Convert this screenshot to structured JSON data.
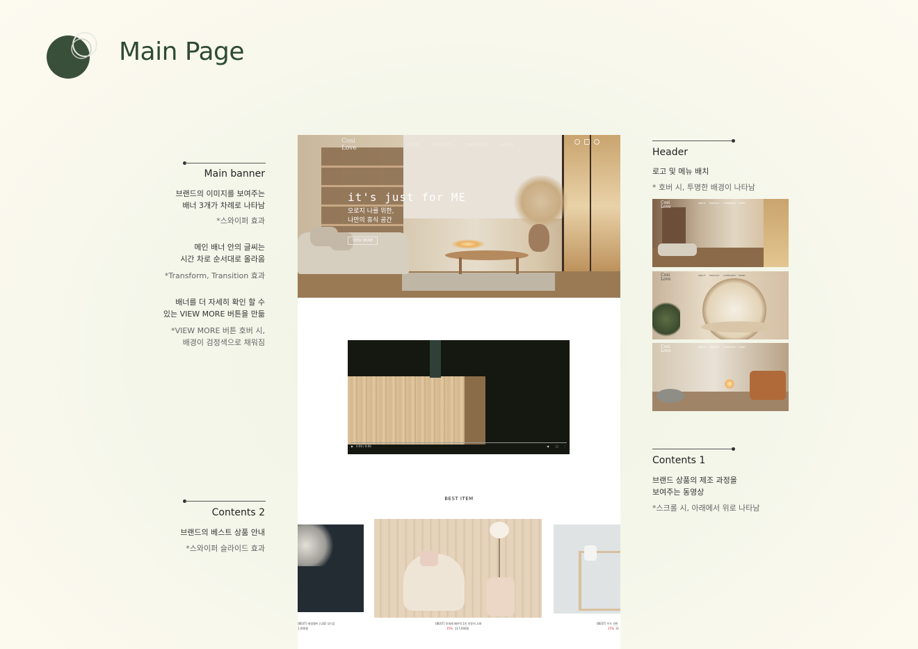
{
  "title": "Main Page",
  "left_annotations": {
    "main_banner": {
      "heading": "Main banner",
      "lines": [
        "브랜드의 이미지를 보여주는",
        "배너 3개가 차례로 나타남"
      ],
      "note": "*스와이퍼 효과",
      "lines2": [
        "메인 배너 안의 글씨는",
        "시간 차로 순서대로 올라옴"
      ],
      "note2": "*Transform, Transition 효과",
      "lines3": [
        "배너를 더 자세히 확인 할 수",
        "있는 VIEW MORE 버튼을 만듦"
      ],
      "note3": [
        "*VIEW MORE 버튼 호버 시,",
        "배경이 검정색으로 채워짐"
      ]
    },
    "contents2": {
      "heading": "Contents 2",
      "line": "브랜드의 베스트 상품 안내",
      "note": "*스와이퍼 슬라이드 효과"
    }
  },
  "right_annotations": {
    "header": {
      "heading": "Header",
      "line": "로고 및 메뉴 배치",
      "note": "* 호버 시, 투명한 배경이 나타남"
    },
    "contents1": {
      "heading": "Contents 1",
      "lines": [
        "브랜드 상품의 제조 과정을",
        "보여주는 동영상"
      ],
      "note": "*스크롤 시, 아래에서 위로 나타남"
    }
  },
  "mockup": {
    "logo": [
      "Cosi",
      "Love"
    ],
    "nav": [
      "ABOUT",
      "PRODUCT",
      "COMMUNITY",
      "EVENT"
    ],
    "headline": "it's just for ME",
    "sub": [
      "오로지 나를 위한,",
      "나만의 휴식 공간"
    ],
    "view_more": "VIEW MORE",
    "video_time": "0:00 / 0:06",
    "best_item": "BEST ITEM",
    "products": [
      {
        "name": "[BEST] 테일램프 | LED 무드등",
        "price": "1,000원"
      },
      {
        "name": "[BEST] 모피레 패브릭 1인 라운지 소파",
        "discount": "15%",
        "price": "117,000원"
      },
      {
        "name": "[BEST] 우드 선반",
        "discount": "15%",
        "price": "11"
      }
    ]
  },
  "thumbnails": {
    "nav": [
      "ABOUT",
      "PRODUCT",
      "COMMUNITY",
      "EVENT"
    ],
    "logo": [
      "Cosi",
      "Love"
    ]
  }
}
